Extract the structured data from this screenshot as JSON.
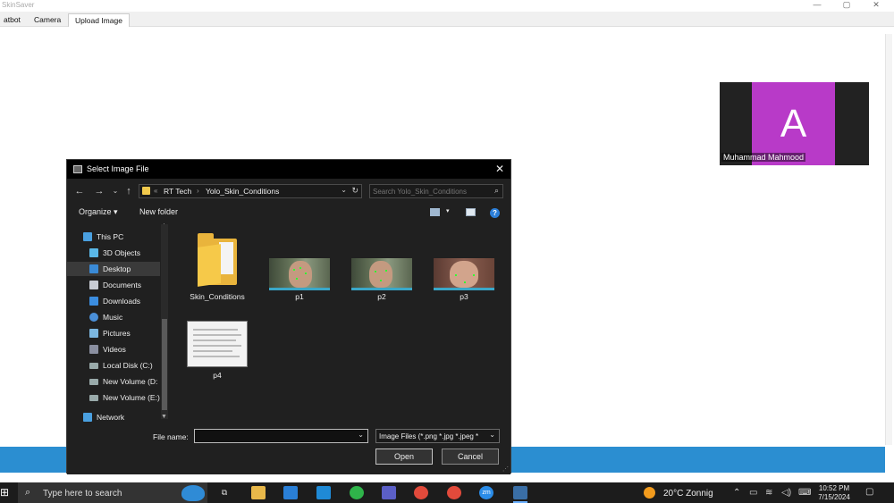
{
  "app": {
    "title": "SkinSaver",
    "tabs": [
      {
        "label": "atbot"
      },
      {
        "label": "Camera"
      },
      {
        "label": "Upload Image",
        "active": true
      }
    ]
  },
  "video_call": {
    "avatar_letter": "A",
    "participant_name": "Muhammad Mahmood",
    "avatar_color": "#b83ac8"
  },
  "dialog": {
    "title": "Select Image File",
    "path": [
      "RT Tech",
      "Yolo_Skin_Conditions"
    ],
    "path_prefix": "«",
    "search_placeholder": "Search Yolo_Skin_Conditions",
    "toolbar": {
      "organize": "Organize ▾",
      "new_folder": "New folder",
      "help": "?"
    },
    "sidebar": [
      {
        "label": "This PC",
        "icon": "pc-icon"
      },
      {
        "label": "3D Objects",
        "icon": "cube-icon"
      },
      {
        "label": "Desktop",
        "icon": "desktop-icon",
        "selected": true
      },
      {
        "label": "Documents",
        "icon": "document-icon"
      },
      {
        "label": "Downloads",
        "icon": "download-icon"
      },
      {
        "label": "Music",
        "icon": "music-icon"
      },
      {
        "label": "Pictures",
        "icon": "pictures-icon"
      },
      {
        "label": "Videos",
        "icon": "video-icon"
      },
      {
        "label": "Local Disk (C:)",
        "icon": "drive-icon"
      },
      {
        "label": "New Volume (D:",
        "icon": "drive-icon"
      },
      {
        "label": "New Volume (E:)",
        "icon": "drive-icon"
      },
      {
        "label": "Network",
        "icon": "network-icon"
      }
    ],
    "files": [
      {
        "name": "Skin_Conditions",
        "kind": "folder"
      },
      {
        "name": "p1",
        "kind": "image"
      },
      {
        "name": "p2",
        "kind": "image"
      },
      {
        "name": "p3",
        "kind": "image"
      },
      {
        "name": "p4",
        "kind": "document-image"
      }
    ],
    "file_name_label": "File name:",
    "file_name_value": "",
    "file_type": "Image Files (*.png *.jpg *.jpeg *",
    "open_label": "Open",
    "cancel_label": "Cancel"
  },
  "taskbar": {
    "search_placeholder": "Type here to search",
    "apps": [
      "task-view-icon",
      "file-explorer-icon",
      "mail-icon",
      "vscode-icon",
      "whatsapp-icon",
      "teams-icon",
      "chrome-icon",
      "chrome-icon",
      "zoom-icon",
      "python-icon"
    ],
    "zoom_label": "zm",
    "weather": "20°C  Zonnig",
    "time": "10:52 PM",
    "date": "7/15/2024"
  },
  "colors": {
    "accent_bar": "#2b8ed1",
    "dialog_bg": "#202020",
    "taskbar_bg": "#1c1c1c"
  }
}
